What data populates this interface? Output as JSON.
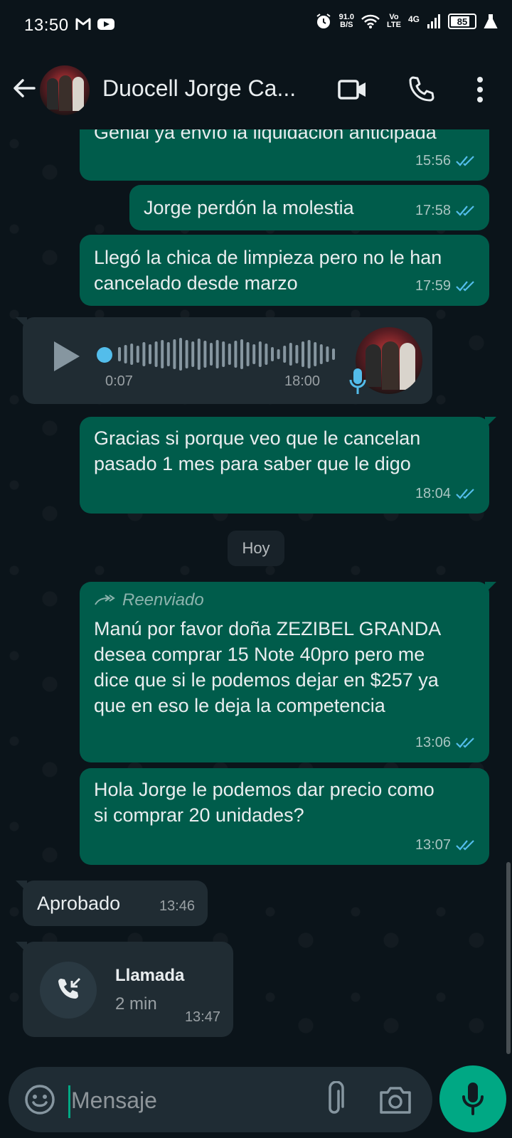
{
  "status_bar": {
    "time": "13:50",
    "net_speed_value": "91.0",
    "net_speed_unit": "B/S",
    "volte_top": "Vo",
    "volte_bottom": "LTE",
    "network": "4G",
    "battery": "85",
    "battery_level": 0.85
  },
  "header": {
    "title": "Duocell Jorge Ca..."
  },
  "messages": [
    {
      "type": "out",
      "text": "Genial ya envío la liquidación anticipada",
      "time": "15:56"
    },
    {
      "type": "out",
      "text": "Jorge perdón la molestia",
      "time": "17:58"
    },
    {
      "type": "out",
      "text": "Llegó la chica de limpieza pero no le han cancelado desde marzo",
      "time": "17:59"
    },
    {
      "type": "voice_in",
      "duration": "0:07",
      "time": "18:00"
    },
    {
      "type": "out",
      "text": "Gracias si porque veo que le cancelan pasado 1 mes para saber que le digo",
      "time": "18:04"
    },
    {
      "type": "date",
      "text": "Hoy"
    },
    {
      "type": "out",
      "forwarded_label": "Reenviado",
      "text": "Manú por favor doña ZEZIBEL GRANDA desea comprar 15 Note 40pro pero me dice que si le podemos dejar en $257 ya que en eso le deja la competencia",
      "time": "13:06"
    },
    {
      "type": "out",
      "text": "Hola Jorge le podemos dar precio como si comprar 20 unidades?",
      "time": "13:07"
    },
    {
      "type": "in",
      "text": "Aprobado",
      "time": "13:46"
    },
    {
      "type": "call_in",
      "title": "Llamada",
      "duration": "2 min",
      "time": "13:47"
    }
  ],
  "input": {
    "placeholder": "Mensaje"
  },
  "icons": {
    "back": "arrow-left-icon",
    "video": "video-camera-icon",
    "call": "phone-icon",
    "menu": "vertical-dots-icon",
    "emoji": "emoji-icon",
    "attach": "paperclip-icon",
    "camera": "camera-icon",
    "mic": "microphone-icon"
  },
  "colors": {
    "background": "#0b141a",
    "outgoing_bubble": "#005c4b",
    "incoming_bubble": "#202c33",
    "accent": "#00a884",
    "read_ticks": "#53bdeb"
  }
}
